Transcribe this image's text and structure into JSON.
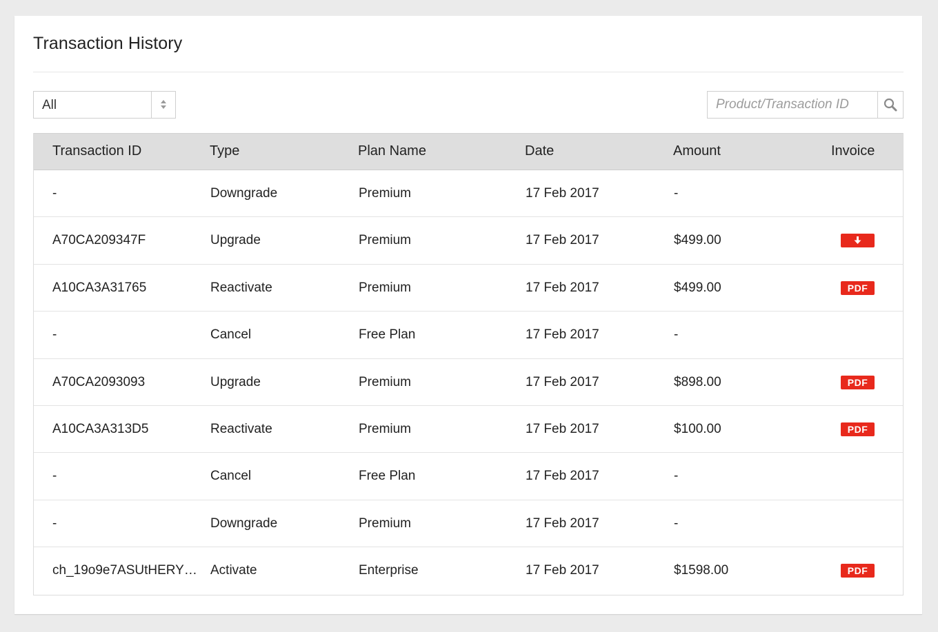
{
  "page": {
    "title": "Transaction History"
  },
  "filter": {
    "selected": "All"
  },
  "search": {
    "placeholder": "Product/Transaction ID"
  },
  "table": {
    "headers": {
      "transaction_id": "Transaction ID",
      "type": "Type",
      "plan_name": "Plan Name",
      "date": "Date",
      "amount": "Amount",
      "invoice": "Invoice"
    },
    "rows": [
      {
        "transaction_id": "-",
        "type": "Downgrade",
        "plan_name": "Premium",
        "date": "17 Feb 2017",
        "amount": "-",
        "invoice": "none",
        "invoice_label": ""
      },
      {
        "transaction_id": "A70CA209347F",
        "type": "Upgrade",
        "plan_name": "Premium",
        "date": "17 Feb 2017",
        "amount": "$499.00",
        "invoice": "download",
        "invoice_label": ""
      },
      {
        "transaction_id": "A10CA3A31765",
        "type": "Reactivate",
        "plan_name": "Premium",
        "date": "17 Feb 2017",
        "amount": "$499.00",
        "invoice": "pdf",
        "invoice_label": "PDF"
      },
      {
        "transaction_id": "-",
        "type": "Cancel",
        "plan_name": "Free Plan",
        "date": "17 Feb 2017",
        "amount": "-",
        "invoice": "none",
        "invoice_label": ""
      },
      {
        "transaction_id": "A70CA2093093",
        "type": "Upgrade",
        "plan_name": "Premium",
        "date": "17 Feb 2017",
        "amount": "$898.00",
        "invoice": "pdf",
        "invoice_label": "PDF"
      },
      {
        "transaction_id": "A10CA3A313D5",
        "type": "Reactivate",
        "plan_name": "Premium",
        "date": "17 Feb 2017",
        "amount": "$100.00",
        "invoice": "pdf",
        "invoice_label": "PDF"
      },
      {
        "transaction_id": "-",
        "type": "Cancel",
        "plan_name": "Free Plan",
        "date": "17 Feb 2017",
        "amount": "-",
        "invoice": "none",
        "invoice_label": ""
      },
      {
        "transaction_id": "-",
        "type": "Downgrade",
        "plan_name": "Premium",
        "date": "17 Feb 2017",
        "amount": "-",
        "invoice": "none",
        "invoice_label": ""
      },
      {
        "transaction_id": "ch_19o9e7ASUtHERYb...",
        "type": "Activate",
        "plan_name": "Enterprise",
        "date": "17 Feb 2017",
        "amount": "$1598.00",
        "invoice": "pdf",
        "invoice_label": "PDF"
      }
    ]
  },
  "icons": {
    "select": "chevron-up-down-icon",
    "search": "search-icon",
    "download": "download-arrow-icon"
  },
  "colors": {
    "background": "#ebebeb",
    "panel": "#ffffff",
    "header_bg": "#dedede",
    "invoice_button": "#e8291c",
    "text": "#222222",
    "placeholder": "#9c9c9c"
  }
}
